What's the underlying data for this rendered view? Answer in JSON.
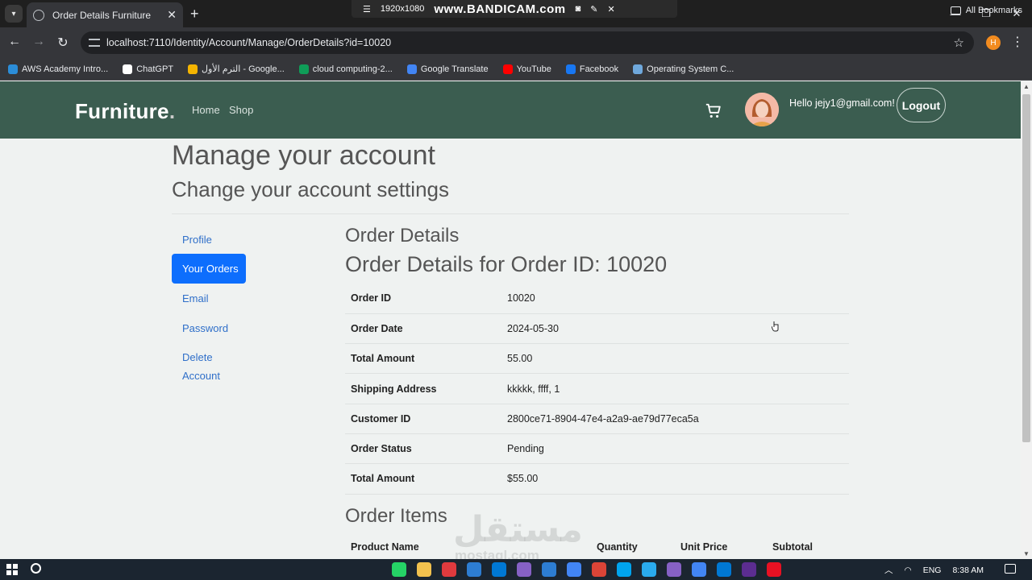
{
  "browser": {
    "tab_title": "Order Details Furniture",
    "new_tab": "+",
    "url": "localhost:7110/Identity/Account/Manage/OrderDetails?id=10020",
    "profile_initial": "H",
    "recorder": {
      "resolution": "1920x1080",
      "brand": "www.BANDICAM.com"
    },
    "bookmarks": [
      {
        "label": "AWS Academy Intro...",
        "color": "#2b8dd8"
      },
      {
        "label": "ChatGPT",
        "color": "#ffffff"
      },
      {
        "label": "الترم الأول - Google...",
        "color": "#f4b400"
      },
      {
        "label": "cloud computing-2...",
        "color": "#0f9d58"
      },
      {
        "label": "Google Translate",
        "color": "#4285f4"
      },
      {
        "label": "YouTube",
        "color": "#ff0000"
      },
      {
        "label": "Facebook",
        "color": "#1877f2"
      },
      {
        "label": "Operating System C...",
        "color": "#6fa8dc"
      }
    ],
    "all_bookmarks": "All Bookmarks"
  },
  "header": {
    "logo": "Furniture",
    "logo_dot": ".",
    "nav": [
      "Home",
      "Shop"
    ],
    "greeting": "Hello jejy1@gmail.com!",
    "logout": "Logout"
  },
  "page": {
    "title": "Manage your account",
    "subtitle": "Change your account settings"
  },
  "sidebar": {
    "items": [
      {
        "label": "Profile",
        "active": false
      },
      {
        "label": "Your Orders",
        "active": true
      },
      {
        "label": "Email",
        "active": false
      },
      {
        "label": "Password",
        "active": false
      },
      {
        "label": "Delete",
        "active": false
      },
      {
        "label": "Account",
        "active": false
      }
    ]
  },
  "order": {
    "title": "Order Details",
    "subtitle": "Order Details for Order ID: 10020",
    "rows": [
      {
        "key": "Order ID",
        "value": "10020"
      },
      {
        "key": "Order Date",
        "value": "2024-05-30"
      },
      {
        "key": "Total Amount",
        "value": "55.00"
      },
      {
        "key": "Shipping Address",
        "value": "kkkkk, ffff, 1"
      },
      {
        "key": "Customer ID",
        "value": "2800ce71-8904-47e4-a2a9-ae79d77eca5a"
      },
      {
        "key": "Order Status",
        "value": "Pending"
      },
      {
        "key": "Total Amount",
        "value": "$55.00"
      }
    ],
    "items_title": "Order Items",
    "items_columns": [
      "Product Name",
      "Quantity",
      "Unit Price",
      "Subtotal"
    ]
  },
  "watermark": {
    "arabic": "مستقل",
    "latin": "mostaql.com"
  },
  "taskbar": {
    "app_colors": [
      "#25d366",
      "#f2c14e",
      "#e03a3e",
      "#2d7dd2",
      "#0078d4",
      "#8661c5",
      "#2d7dd2",
      "#4285f4",
      "#db4437",
      "#00a4ef",
      "#2aabee",
      "#8661c5",
      "#4285f4",
      "#0078d4",
      "#5c2d91",
      "#e81123"
    ],
    "lang": "ENG",
    "time": "8:38 AM"
  }
}
